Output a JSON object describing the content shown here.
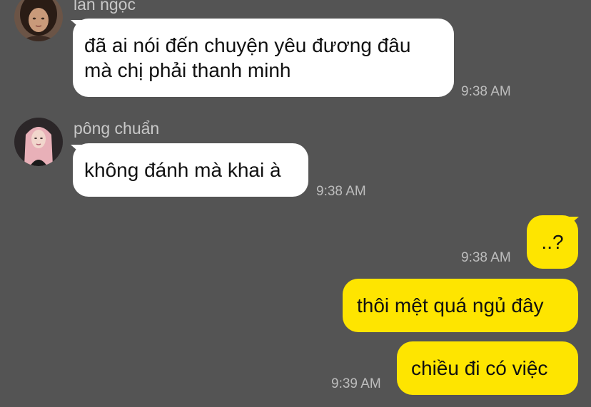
{
  "colors": {
    "background": "#545454",
    "incoming_bubble": "#ffffff",
    "outgoing_bubble": "#fee500",
    "timestamp": "#bdbdbd",
    "sender_name": "#c8c8c8"
  },
  "messages": [
    {
      "sender": "lan ngọc",
      "avatar_icon": "avatar-woman-dark-hair",
      "lines": [
        "đã ai nói đến chuyện yêu đương đâu",
        "mà chị phải thanh minh"
      ],
      "time": "9:38 AM",
      "direction": "incoming"
    },
    {
      "sender": "pông chuẩn",
      "avatar_icon": "avatar-woman-pink-hair",
      "lines": [
        "không đánh mà khai à"
      ],
      "time": "9:38 AM",
      "direction": "incoming"
    },
    {
      "lines": [
        "..?"
      ],
      "time": "9:38 AM",
      "direction": "outgoing"
    },
    {
      "lines": [
        "thôi mệt quá ngủ đây"
      ],
      "direction": "outgoing"
    },
    {
      "lines": [
        "chiều đi có việc"
      ],
      "time": "9:39 AM",
      "direction": "outgoing"
    }
  ]
}
